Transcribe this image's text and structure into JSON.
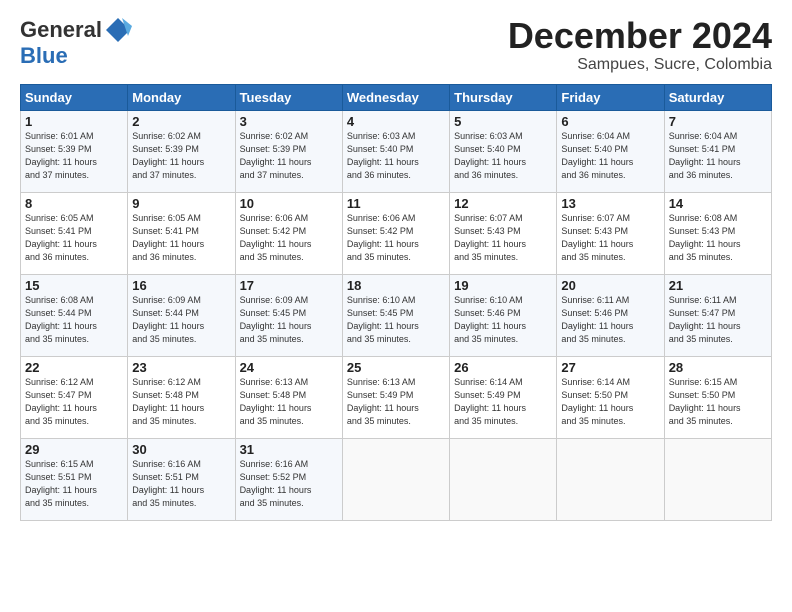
{
  "header": {
    "logo_general": "General",
    "logo_blue": "Blue",
    "month_title": "December 2024",
    "location": "Sampues, Sucre, Colombia"
  },
  "days_of_week": [
    "Sunday",
    "Monday",
    "Tuesday",
    "Wednesday",
    "Thursday",
    "Friday",
    "Saturday"
  ],
  "weeks": [
    [
      {
        "day": 1,
        "info": "Sunrise: 6:01 AM\nSunset: 5:39 PM\nDaylight: 11 hours\nand 37 minutes."
      },
      {
        "day": 2,
        "info": "Sunrise: 6:02 AM\nSunset: 5:39 PM\nDaylight: 11 hours\nand 37 minutes."
      },
      {
        "day": 3,
        "info": "Sunrise: 6:02 AM\nSunset: 5:39 PM\nDaylight: 11 hours\nand 37 minutes."
      },
      {
        "day": 4,
        "info": "Sunrise: 6:03 AM\nSunset: 5:40 PM\nDaylight: 11 hours\nand 36 minutes."
      },
      {
        "day": 5,
        "info": "Sunrise: 6:03 AM\nSunset: 5:40 PM\nDaylight: 11 hours\nand 36 minutes."
      },
      {
        "day": 6,
        "info": "Sunrise: 6:04 AM\nSunset: 5:40 PM\nDaylight: 11 hours\nand 36 minutes."
      },
      {
        "day": 7,
        "info": "Sunrise: 6:04 AM\nSunset: 5:41 PM\nDaylight: 11 hours\nand 36 minutes."
      }
    ],
    [
      {
        "day": 8,
        "info": "Sunrise: 6:05 AM\nSunset: 5:41 PM\nDaylight: 11 hours\nand 36 minutes."
      },
      {
        "day": 9,
        "info": "Sunrise: 6:05 AM\nSunset: 5:41 PM\nDaylight: 11 hours\nand 36 minutes."
      },
      {
        "day": 10,
        "info": "Sunrise: 6:06 AM\nSunset: 5:42 PM\nDaylight: 11 hours\nand 35 minutes."
      },
      {
        "day": 11,
        "info": "Sunrise: 6:06 AM\nSunset: 5:42 PM\nDaylight: 11 hours\nand 35 minutes."
      },
      {
        "day": 12,
        "info": "Sunrise: 6:07 AM\nSunset: 5:43 PM\nDaylight: 11 hours\nand 35 minutes."
      },
      {
        "day": 13,
        "info": "Sunrise: 6:07 AM\nSunset: 5:43 PM\nDaylight: 11 hours\nand 35 minutes."
      },
      {
        "day": 14,
        "info": "Sunrise: 6:08 AM\nSunset: 5:43 PM\nDaylight: 11 hours\nand 35 minutes."
      }
    ],
    [
      {
        "day": 15,
        "info": "Sunrise: 6:08 AM\nSunset: 5:44 PM\nDaylight: 11 hours\nand 35 minutes."
      },
      {
        "day": 16,
        "info": "Sunrise: 6:09 AM\nSunset: 5:44 PM\nDaylight: 11 hours\nand 35 minutes."
      },
      {
        "day": 17,
        "info": "Sunrise: 6:09 AM\nSunset: 5:45 PM\nDaylight: 11 hours\nand 35 minutes."
      },
      {
        "day": 18,
        "info": "Sunrise: 6:10 AM\nSunset: 5:45 PM\nDaylight: 11 hours\nand 35 minutes."
      },
      {
        "day": 19,
        "info": "Sunrise: 6:10 AM\nSunset: 5:46 PM\nDaylight: 11 hours\nand 35 minutes."
      },
      {
        "day": 20,
        "info": "Sunrise: 6:11 AM\nSunset: 5:46 PM\nDaylight: 11 hours\nand 35 minutes."
      },
      {
        "day": 21,
        "info": "Sunrise: 6:11 AM\nSunset: 5:47 PM\nDaylight: 11 hours\nand 35 minutes."
      }
    ],
    [
      {
        "day": 22,
        "info": "Sunrise: 6:12 AM\nSunset: 5:47 PM\nDaylight: 11 hours\nand 35 minutes."
      },
      {
        "day": 23,
        "info": "Sunrise: 6:12 AM\nSunset: 5:48 PM\nDaylight: 11 hours\nand 35 minutes."
      },
      {
        "day": 24,
        "info": "Sunrise: 6:13 AM\nSunset: 5:48 PM\nDaylight: 11 hours\nand 35 minutes."
      },
      {
        "day": 25,
        "info": "Sunrise: 6:13 AM\nSunset: 5:49 PM\nDaylight: 11 hours\nand 35 minutes."
      },
      {
        "day": 26,
        "info": "Sunrise: 6:14 AM\nSunset: 5:49 PM\nDaylight: 11 hours\nand 35 minutes."
      },
      {
        "day": 27,
        "info": "Sunrise: 6:14 AM\nSunset: 5:50 PM\nDaylight: 11 hours\nand 35 minutes."
      },
      {
        "day": 28,
        "info": "Sunrise: 6:15 AM\nSunset: 5:50 PM\nDaylight: 11 hours\nand 35 minutes."
      }
    ],
    [
      {
        "day": 29,
        "info": "Sunrise: 6:15 AM\nSunset: 5:51 PM\nDaylight: 11 hours\nand 35 minutes."
      },
      {
        "day": 30,
        "info": "Sunrise: 6:16 AM\nSunset: 5:51 PM\nDaylight: 11 hours\nand 35 minutes."
      },
      {
        "day": 31,
        "info": "Sunrise: 6:16 AM\nSunset: 5:52 PM\nDaylight: 11 hours\nand 35 minutes."
      },
      null,
      null,
      null,
      null
    ]
  ]
}
